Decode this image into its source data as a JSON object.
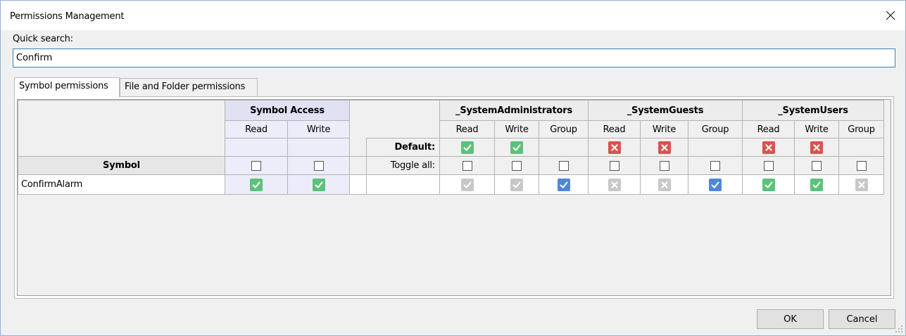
{
  "window": {
    "title": "Permissions Management"
  },
  "search": {
    "label": "Quick search:",
    "value": "Confirm"
  },
  "tabs": [
    {
      "label": "Symbol permissions",
      "active": true
    },
    {
      "label": "File and Folder permissions",
      "active": false
    }
  ],
  "grid": {
    "symbol_access_header": "Symbol Access",
    "symbol_access_cols": [
      "Read",
      "Write"
    ],
    "symbol_header": "Symbol",
    "default_label": "Default:",
    "toggle_all_label": "Toggle all:",
    "groups": [
      {
        "name": "_SystemAdministrators",
        "cols": [
          "Read",
          "Write",
          "Group"
        ],
        "defaults": [
          "green-check",
          "green-check",
          ""
        ],
        "row_icons": [
          "grey-check",
          "grey-check",
          "blue-check"
        ]
      },
      {
        "name": "_SystemGuests",
        "cols": [
          "Read",
          "Write",
          "Group"
        ],
        "defaults": [
          "red-cross",
          "red-cross",
          ""
        ],
        "row_icons": [
          "grey-cross",
          "grey-cross",
          "blue-check"
        ]
      },
      {
        "name": "_SystemUsers",
        "cols": [
          "Read",
          "Write",
          "Group"
        ],
        "defaults": [
          "red-cross",
          "red-cross",
          ""
        ],
        "row_icons": [
          "green-check",
          "green-check",
          "grey-cross"
        ]
      }
    ],
    "rows": [
      {
        "symbol": "ConfirmAlarm",
        "access": [
          "green-check",
          "green-check"
        ]
      }
    ]
  },
  "buttons": {
    "ok": "OK",
    "cancel": "Cancel"
  },
  "colors": {
    "green": "#5cc27b",
    "red": "#d9534f",
    "grey": "#c8c8c8",
    "blue": "#4f86d9",
    "symbol_access_bg": "#e1e1f4"
  }
}
